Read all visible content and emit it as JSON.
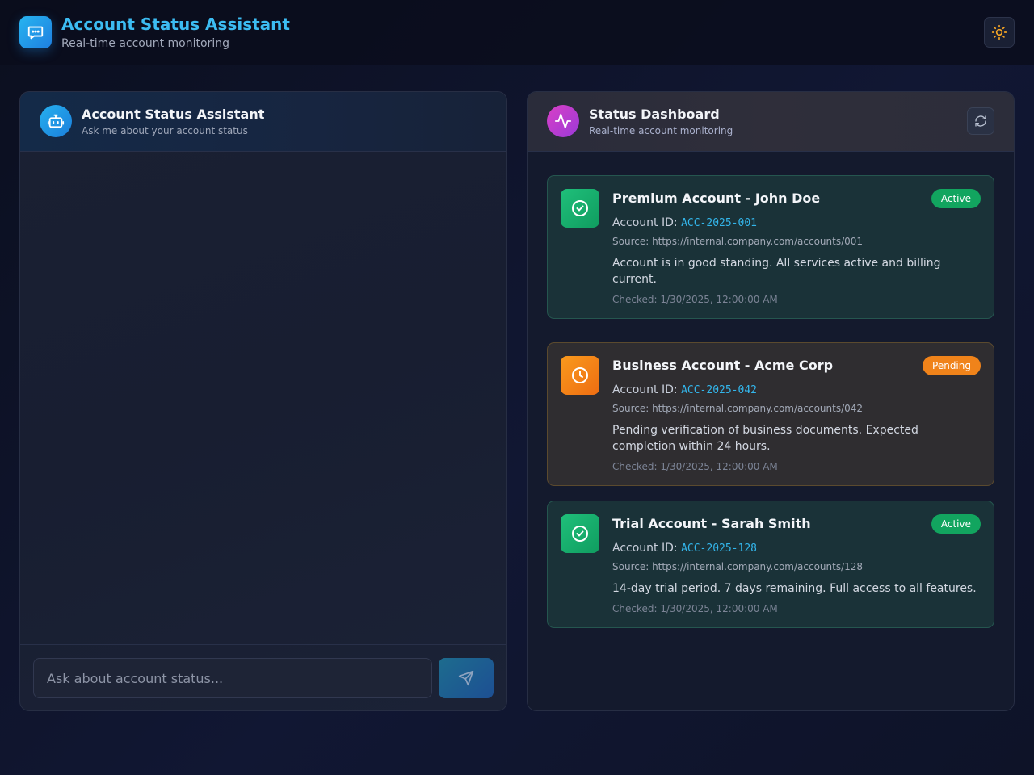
{
  "header": {
    "title": "Account Status Assistant",
    "subtitle": "Real-time account monitoring",
    "theme_icon": "sun-icon"
  },
  "chat": {
    "title": "Account Status Assistant",
    "subtitle": "Ask me about your account status",
    "icon": "robot-icon",
    "input_placeholder": "Ask about account status...",
    "send_icon": "send-icon"
  },
  "dashboard": {
    "title": "Status Dashboard",
    "subtitle": "Real-time account monitoring",
    "icon": "activity-icon",
    "refresh_icon": "refresh-icon",
    "id_label": "Account ID: ",
    "cards": [
      {
        "title": "Premium Account - John Doe",
        "status": "Active",
        "account_id": "ACC-2025-001",
        "source": "Source: https://internal.company.com/accounts/001",
        "description": "Account is in good standing. All services active and billing current.",
        "checked": "Checked: 1/30/2025, 12:00:00 AM",
        "icon": "check-circle-icon"
      },
      {
        "title": "Business Account - Acme Corp",
        "status": "Pending",
        "account_id": "ACC-2025-042",
        "source": "Source: https://internal.company.com/accounts/042",
        "description": "Pending verification of business documents. Expected completion within 24 hours.",
        "checked": "Checked: 1/30/2025, 12:00:00 AM",
        "icon": "clock-icon"
      },
      {
        "title": "Trial Account - Sarah Smith",
        "status": "Active",
        "account_id": "ACC-2025-128",
        "source": "Source: https://internal.company.com/accounts/128",
        "description": "14-day trial period. 7 days remaining. Full access to all features.",
        "checked": "Checked: 1/30/2025, 12:00:00 AM",
        "icon": "check-circle-icon"
      }
    ]
  },
  "colors": {
    "accent": "#3cbcf2",
    "active": "#12a55f",
    "pending": "#f0831a",
    "id_text": "#33b5ea"
  }
}
